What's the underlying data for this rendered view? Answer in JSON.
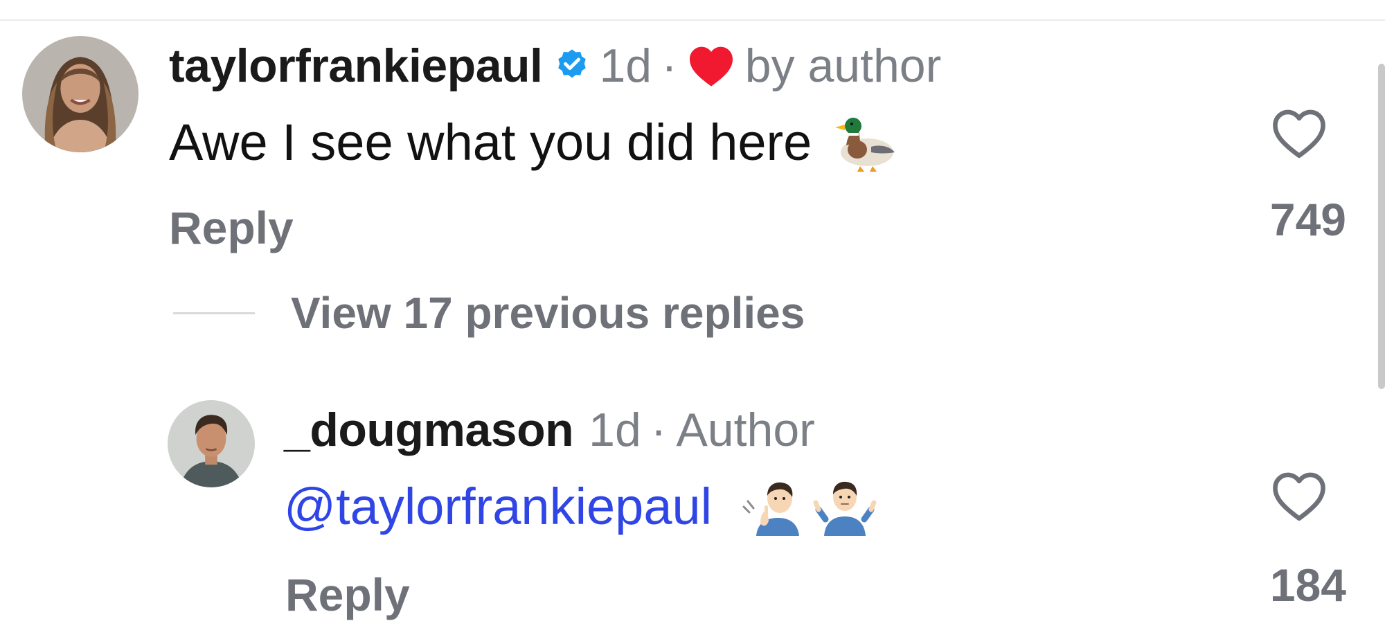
{
  "comments": [
    {
      "username": "taylorfrankiepaul",
      "verified": true,
      "time": "1d",
      "separator": "·",
      "liked_by_author_label": "by author",
      "text": "Awe I see what you did here",
      "text_emoji": "duck",
      "reply_label": "Reply",
      "likes": "749",
      "heart_color": "#f0192f"
    },
    {
      "username": "_dougmason",
      "time": "1d",
      "separator": "·",
      "role_label": "Author",
      "mention": "@taylorfrankiepaul",
      "text_emojis": [
        "person-gesturing-ok",
        "person-shrugging"
      ],
      "reply_label": "Reply",
      "likes": "184",
      "mention_color": "#2f45e6"
    }
  ],
  "thread": {
    "view_replies_label": "View 17 previous replies"
  },
  "colors": {
    "verified_badge": "#1d9bf0",
    "secondary_text": "#6e7178"
  },
  "icons": {
    "verified": "verified-badge-icon",
    "liked_by_author": "heart-filled-icon",
    "like": "heart-outline-icon"
  }
}
